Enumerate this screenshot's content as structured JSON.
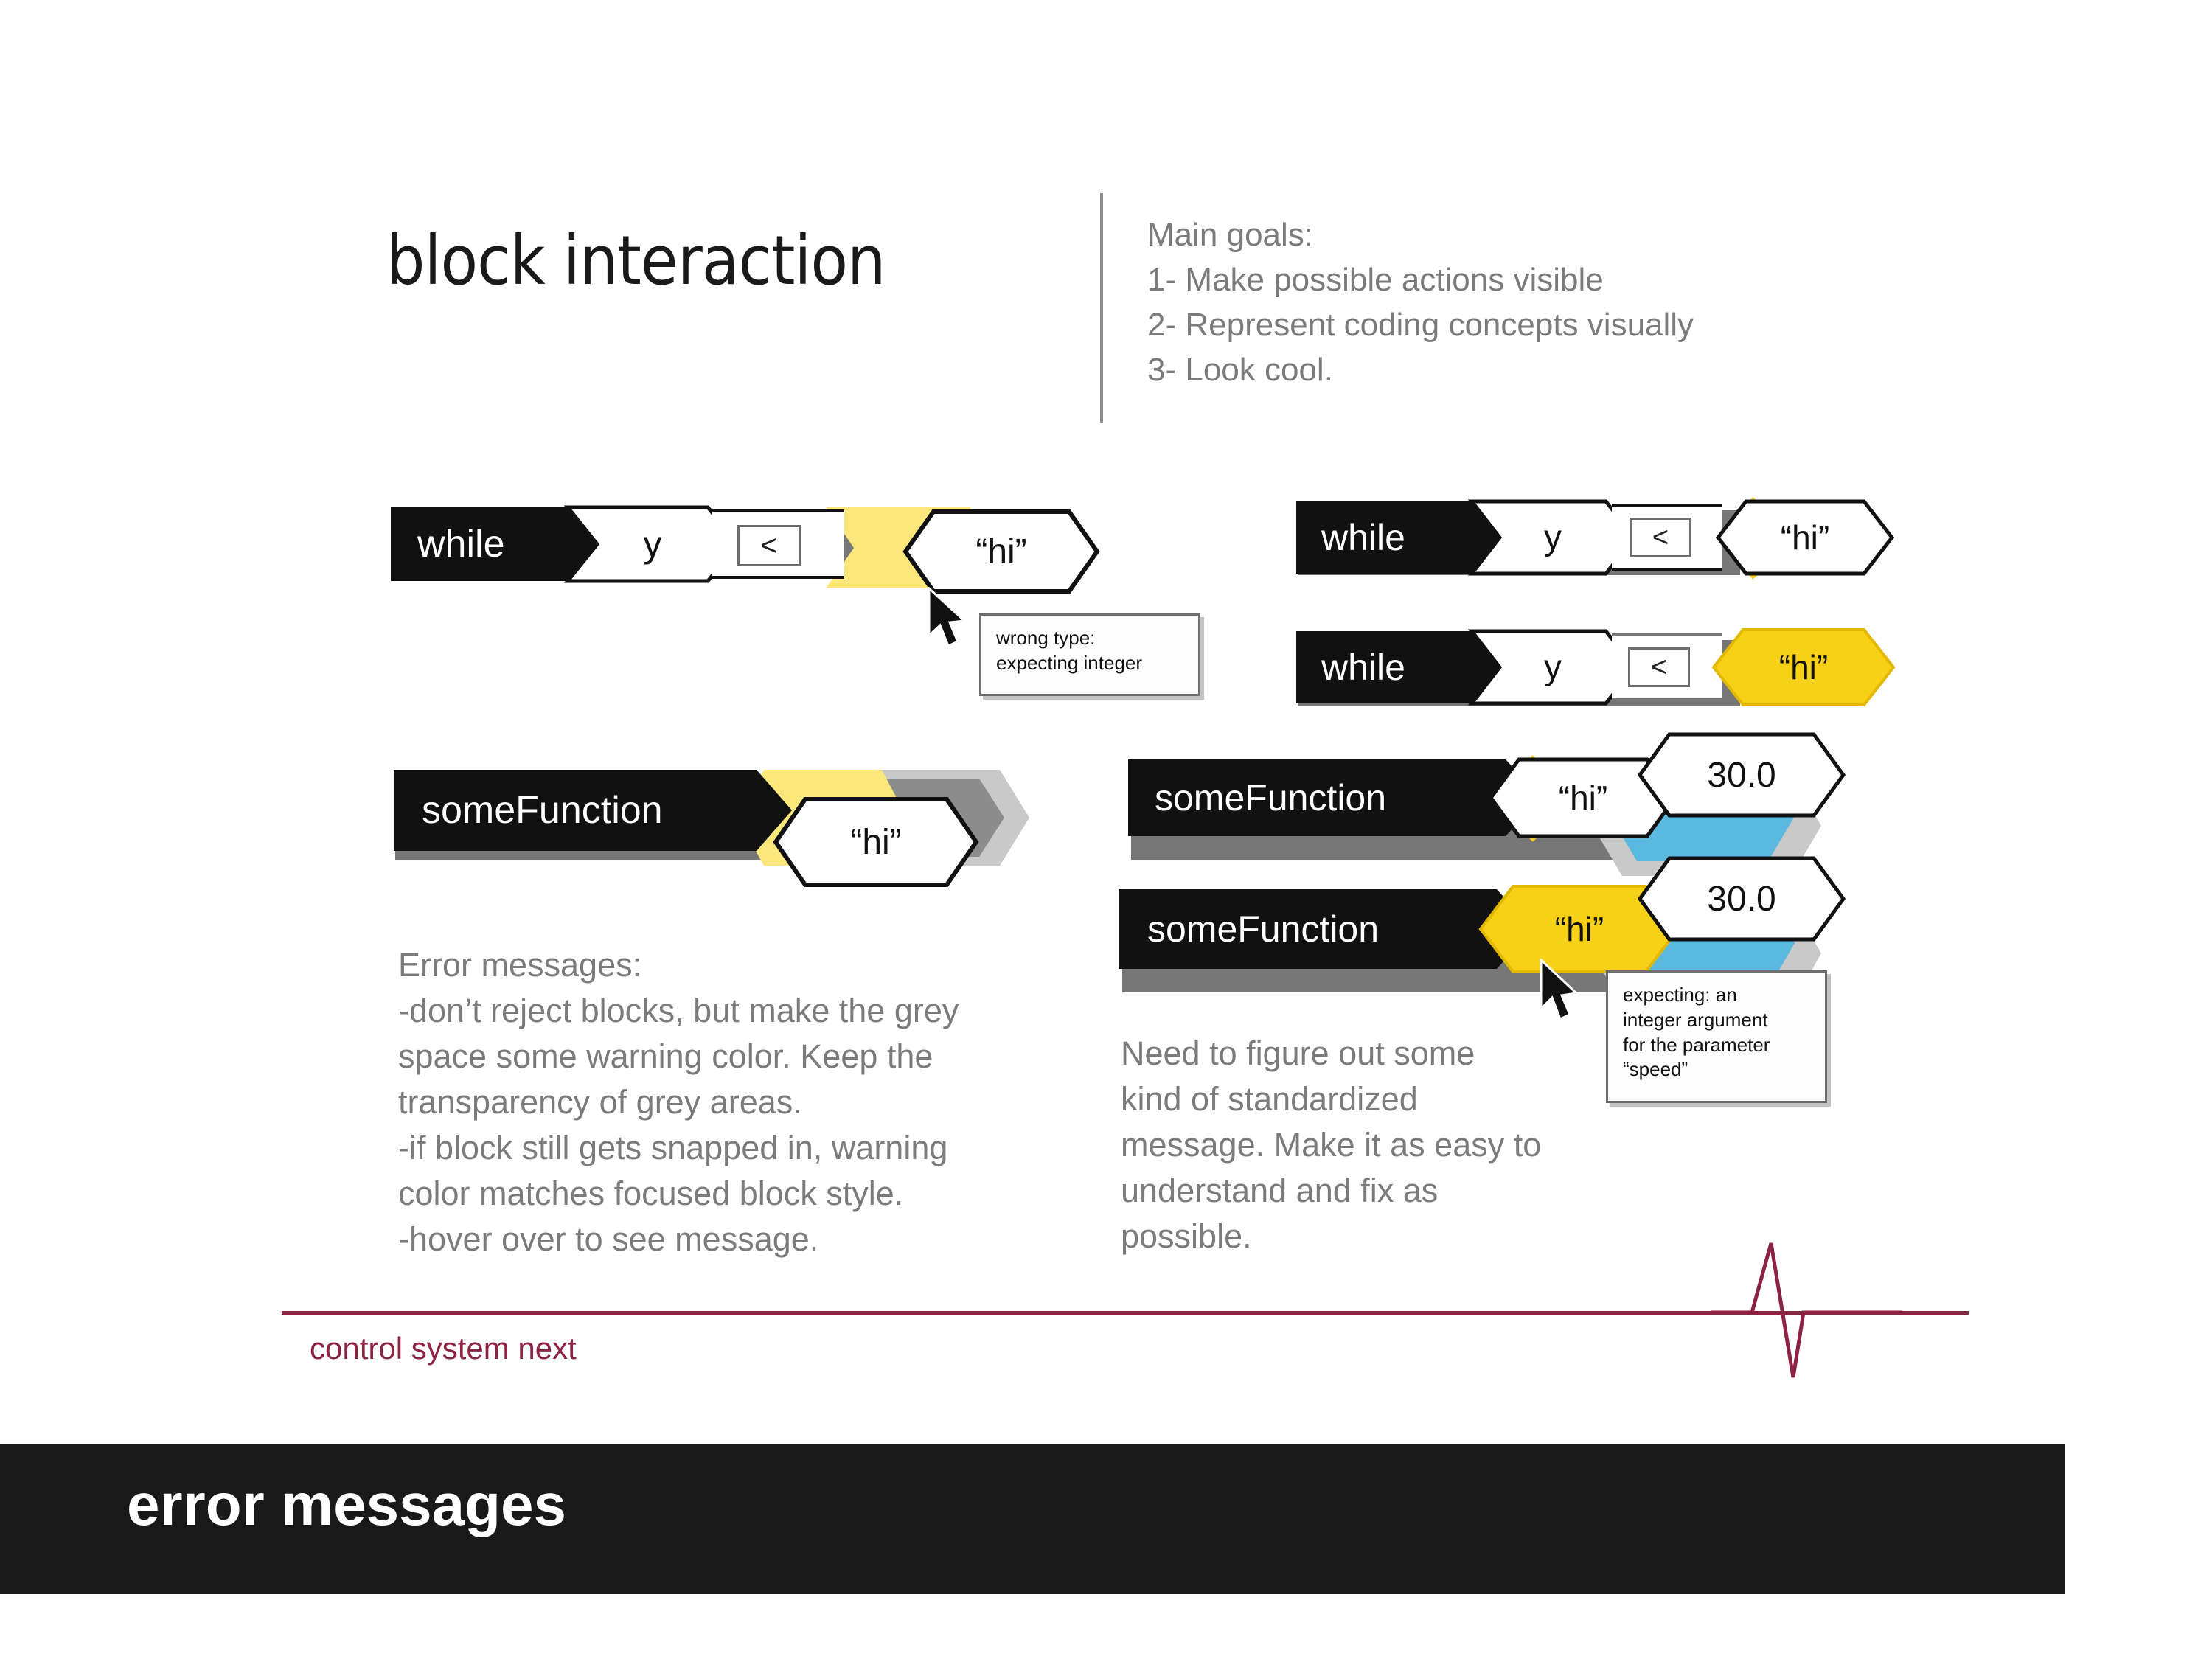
{
  "slide": {
    "title": "block interaction",
    "goals": [
      "Main goals:",
      "1- Make possible actions visible",
      "2- Represent coding concepts visually",
      "3- Look cool."
    ],
    "footer_title": "error messages",
    "next_label": "control system next"
  },
  "colors": {
    "yellow_solid": "#F7D117",
    "yellow_pale": "#FBE77C",
    "blue_slot": "#5BB8DE",
    "grey_slot": "#8C8C8C",
    "grey_halo": "#C9C9C9",
    "black_block": "#111111",
    "text_grey": "#7B7B7B",
    "accent_red": "#8D2343",
    "footer_bg": "#191919"
  },
  "blocks": {
    "while_error": {
      "keyword": "while",
      "variable": "y",
      "operator": "<",
      "argument": "“hi”",
      "slot_state": "pale-yellow-warning",
      "cursor": true
    },
    "while_hover": {
      "keyword": "while",
      "variable": "y",
      "operator": "<",
      "argument": "“hi”",
      "slot_state": "yellow-outline"
    },
    "while_snapped": {
      "keyword": "while",
      "variable": "y",
      "operator": "<",
      "argument": "“hi”",
      "slot_state": "yellow-filled"
    },
    "somefunction_error": {
      "keyword": "someFunction",
      "argument": "“hi”",
      "slot_state": "pale-yellow-and-grey"
    },
    "somefunction_hover": {
      "keyword": "someFunction",
      "argument": "“hi”",
      "second_argument": "30.0",
      "slot_state": "yellow-outline-blue-slot"
    },
    "somefunction_snapped": {
      "keyword": "someFunction",
      "argument": "“hi”",
      "second_argument": "30.0",
      "slot_state": "yellow-filled-blue-slot",
      "cursor": true
    }
  },
  "tooltips": {
    "wrong_type": [
      "wrong type:",
      "expecting integer"
    ],
    "expecting_speed": [
      "expecting: an",
      "integer argument",
      "for the parameter",
      "“speed”"
    ]
  },
  "notes": {
    "left": [
      "Error messages:",
      "-don’t reject blocks, but make the grey",
      "space some warning color. Keep the",
      "transparency of grey areas.",
      "-if block still gets snapped in,  warning",
      "color matches focused block style.",
      "-hover over to see message."
    ],
    "right": [
      "Need to figure out some",
      "kind of standardized",
      "message. Make it as easy to",
      "understand and fix as",
      "possible."
    ]
  }
}
